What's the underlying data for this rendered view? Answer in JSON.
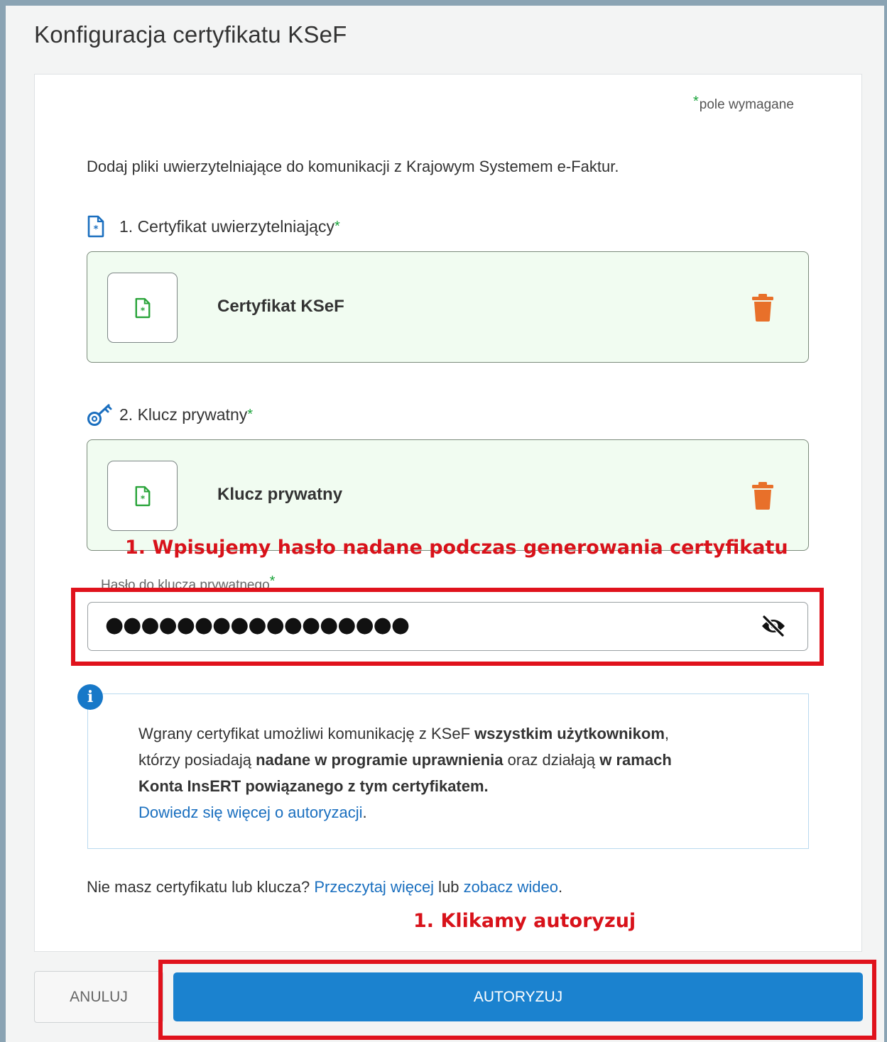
{
  "dialog": {
    "title": "Konfiguracja certyfikatu KSeF",
    "required_star": "*",
    "required_note": "pole wymagane",
    "intro": "Dodaj pliki uwierzytelniające do komunikacji z Krajowym Systemem e-Faktur."
  },
  "certificate": {
    "heading": "1. Certyfikat uwierzytelniający",
    "star": "*",
    "file_name": "Certyfikat KSeF",
    "icon": "certificate-file-icon",
    "delete_icon": "trash-icon"
  },
  "private_key": {
    "heading": "2. Klucz prywatny",
    "star": "*",
    "file_name": "Klucz prywatny",
    "icon": "key-icon",
    "delete_icon": "trash-icon"
  },
  "password": {
    "label": "Hasło do klucza prywatnego",
    "star": "*",
    "masked_value": "●●●●●●●●●●●●●●●●●",
    "toggle_icon": "eye-off-icon"
  },
  "info": {
    "part1": "Wgrany certyfikat umożliwi komunikację z KSeF ",
    "bold1": "wszystkim użytkownikom",
    "part2": ",",
    "part3": "którzy posiadają ",
    "bold2": "nadane w programie uprawnienia",
    "part4": " oraz działają ",
    "bold3": "w ramach",
    "bold4": "Konta InsERT powiązanego z tym certyfikatem.",
    "link": "Dowiedz się więcej o autoryzacji",
    "link_suffix": "."
  },
  "bottom_note": {
    "text1": "Nie masz certyfikatu lub klucza? ",
    "link1": "Przeczytaj więcej",
    "text2": " lub ",
    "link2": "zobacz wideo",
    "text3": "."
  },
  "buttons": {
    "cancel": "ANULUJ",
    "authorize": "AUTORYZUJ"
  },
  "annotations": {
    "password_hint": "1. Wpisujemy hasło nadane podczas generowania certyfikatu",
    "authorize_hint": "1. Klikamy autoryzuj"
  },
  "colors": {
    "accent_blue": "#1b82cf",
    "annotation_red": "#e0121c",
    "file_green": "#2aa43a",
    "trash_orange": "#e8702a"
  }
}
